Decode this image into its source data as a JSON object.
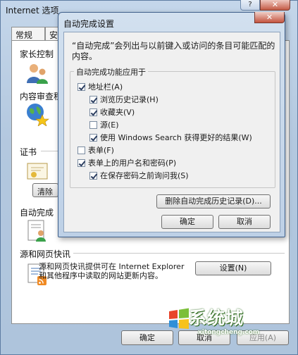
{
  "outer": {
    "title": "Internet 选项",
    "help_label": "?",
    "close_label": "✕",
    "tabs": [
      "常规",
      "安"
    ],
    "sections": {
      "parental": "家长控制",
      "content_advisor": "内容审查程",
      "certificates": "证书",
      "clear_button": "清除",
      "autocomplete": "自动完成",
      "feeds": "源和网页快讯",
      "feeds_description": "源和网页快讯提供可在 Internet Explorer 和其他程序中读取的网站更新内容。",
      "feeds_settings_button": "设置(N)"
    },
    "buttons": {
      "ok": "确定",
      "cancel": "取消",
      "apply": "应用(A)"
    },
    "watermark": {
      "brand": "系统城",
      "url": "xitongcheng.com"
    }
  },
  "autocomplete_dialog": {
    "title": "自动完成设置",
    "close_label": "✕",
    "description": "“自动完成”会列出与以前键入或访问的条目可能匹配的内容。",
    "group_label": "自动完成功能应用于",
    "options": [
      {
        "label": "地址栏(A)",
        "checked": true,
        "level": 0
      },
      {
        "label": "浏览历史记录(H)",
        "checked": true,
        "level": 1
      },
      {
        "label": "收藏夹(V)",
        "checked": true,
        "level": 1
      },
      {
        "label": "源(E)",
        "checked": false,
        "level": 1
      },
      {
        "label": "使用 Windows Search 获得更好的结果(W)",
        "checked": true,
        "level": 1
      },
      {
        "label": "表单(F)",
        "checked": false,
        "level": 0
      },
      {
        "label": "表单上的用户名和密码(P)",
        "checked": true,
        "level": 0
      },
      {
        "label": "在保存密码之前询问我(S)",
        "checked": true,
        "level": 1
      }
    ],
    "delete_history_button": "删除自动完成历史记录(D)...",
    "ok_button": "确定",
    "cancel_button": "取消"
  }
}
